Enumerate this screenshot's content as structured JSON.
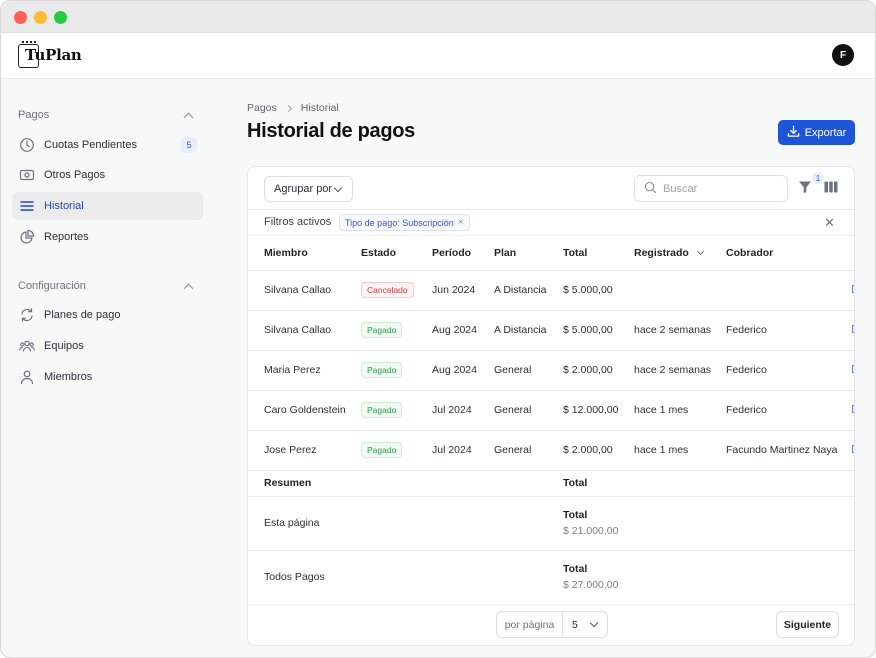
{
  "app": {
    "name": "TuPlan",
    "user_initial": "F"
  },
  "sidebar": {
    "sections": [
      {
        "title": "Pagos",
        "items": [
          {
            "label": "Cuotas Pendientes",
            "icon": "clock-icon",
            "badge": "5"
          },
          {
            "label": "Otros Pagos",
            "icon": "cash-icon"
          },
          {
            "label": "Historial",
            "icon": "list-icon",
            "active": true
          },
          {
            "label": "Reportes",
            "icon": "pie-chart-icon"
          }
        ]
      },
      {
        "title": "Configuración",
        "items": [
          {
            "label": "Planes de pago",
            "icon": "refresh-icon"
          },
          {
            "label": "Equipos",
            "icon": "team-icon"
          },
          {
            "label": "Miembros",
            "icon": "user-icon"
          }
        ]
      }
    ]
  },
  "breadcrumb": {
    "parent": "Pagos",
    "current": "Historial"
  },
  "page": {
    "title": "Historial de pagos",
    "export_label": "Exportar"
  },
  "toolbar": {
    "group_by_label": "Agrupar por",
    "search_placeholder": "Buscar",
    "filter_count": "1"
  },
  "filters": {
    "label": "Filtros activos",
    "chips": [
      {
        "label": "Tipo de pago: Subscripción"
      }
    ]
  },
  "table": {
    "columns": [
      "Miembro",
      "Estado",
      "Período",
      "Plan",
      "Total",
      "Registrado",
      "Cobrador"
    ],
    "rows": [
      {
        "member": "Silvana Callao",
        "status": "Cancelado",
        "status_type": "cancel",
        "period": "Jun 2024",
        "plan": "A Distancia",
        "total": "$ 5.000,00",
        "registered": "",
        "collector": ""
      },
      {
        "member": "Silvana Callao",
        "status": "Pagado",
        "status_type": "paid",
        "period": "Aug 2024",
        "plan": "A Distancia",
        "total": "$ 5.000,00",
        "registered": "hace 2 semanas",
        "collector": "Federico"
      },
      {
        "member": "Maria Perez",
        "status": "Pagado",
        "status_type": "paid",
        "period": "Aug 2024",
        "plan": "General",
        "total": "$ 2.000,00",
        "registered": "hace 2 semanas",
        "collector": "Federico"
      },
      {
        "member": "Caro Goldenstein",
        "status": "Pagado",
        "status_type": "paid",
        "period": "Jul 2024",
        "plan": "General",
        "total": "$ 12.000,00",
        "registered": "hace 1 mes",
        "collector": "Federico"
      },
      {
        "member": "Jose Perez",
        "status": "Pagado",
        "status_type": "paid",
        "period": "Jul 2024",
        "plan": "General",
        "total": "$ 2.000,00",
        "registered": "hace 1 mes",
        "collector": "Facundo Martinez Naya"
      }
    ]
  },
  "summary": {
    "header": {
      "label": "Resumen",
      "total": "Total"
    },
    "rows": [
      {
        "label": "Esta página",
        "total_label": "Total",
        "total_value": "$ 21.000,00"
      },
      {
        "label": "Todos Pagos",
        "total_label": "Total",
        "total_value": "$ 27.000,00"
      }
    ]
  },
  "pagination": {
    "per_page_label": "por página",
    "per_page_value": "5",
    "next_label": "Siguiente"
  },
  "colors": {
    "accent": "#1e55d6",
    "active_text": "#1f47c7",
    "cancel": "#d33b3b",
    "paid": "#2f9a4a"
  }
}
